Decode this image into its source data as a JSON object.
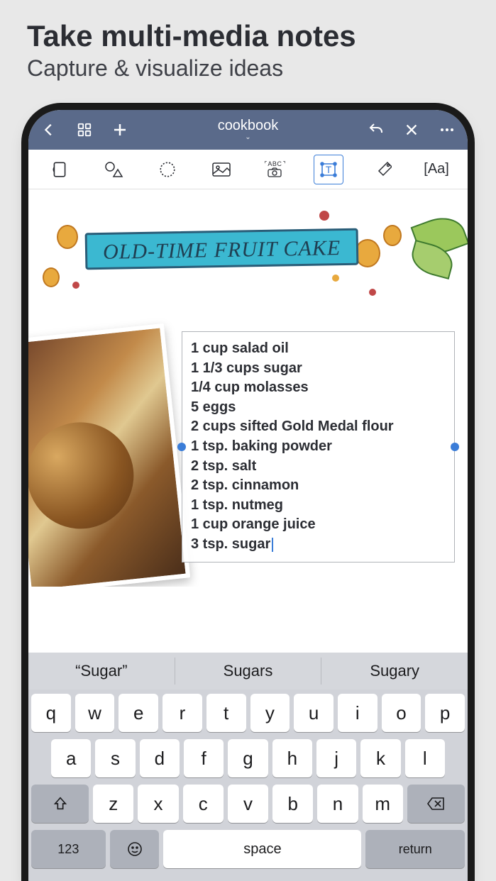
{
  "promo": {
    "title": "Take multi-media notes",
    "subtitle": "Capture & visualize ideas"
  },
  "navbar": {
    "title": "cookbook"
  },
  "toolbar": {
    "camera_label": "ABC"
  },
  "canvas": {
    "recipe_title": "OLD-TIME FRUIT CAKE",
    "ingredients": [
      "1 cup salad oil",
      "1 1/3 cups sugar",
      "1/4 cup molasses",
      "5 eggs",
      "2 cups sifted Gold Medal flour",
      "1 tsp. baking powder",
      "2 tsp. salt",
      "2 tsp. cinnamon",
      "1 tsp. nutmeg",
      "1 cup orange juice",
      "3 tsp. sugar"
    ]
  },
  "keyboard": {
    "suggestions": [
      "“Sugar”",
      "Sugars",
      "Sugary"
    ],
    "row1": [
      "q",
      "w",
      "e",
      "r",
      "t",
      "y",
      "u",
      "i",
      "o",
      "p"
    ],
    "row2": [
      "a",
      "s",
      "d",
      "f",
      "g",
      "h",
      "j",
      "k",
      "l"
    ],
    "row3": [
      "z",
      "x",
      "c",
      "v",
      "b",
      "n",
      "m"
    ],
    "numbers_label": "123",
    "space_label": "space",
    "return_label": "return"
  }
}
